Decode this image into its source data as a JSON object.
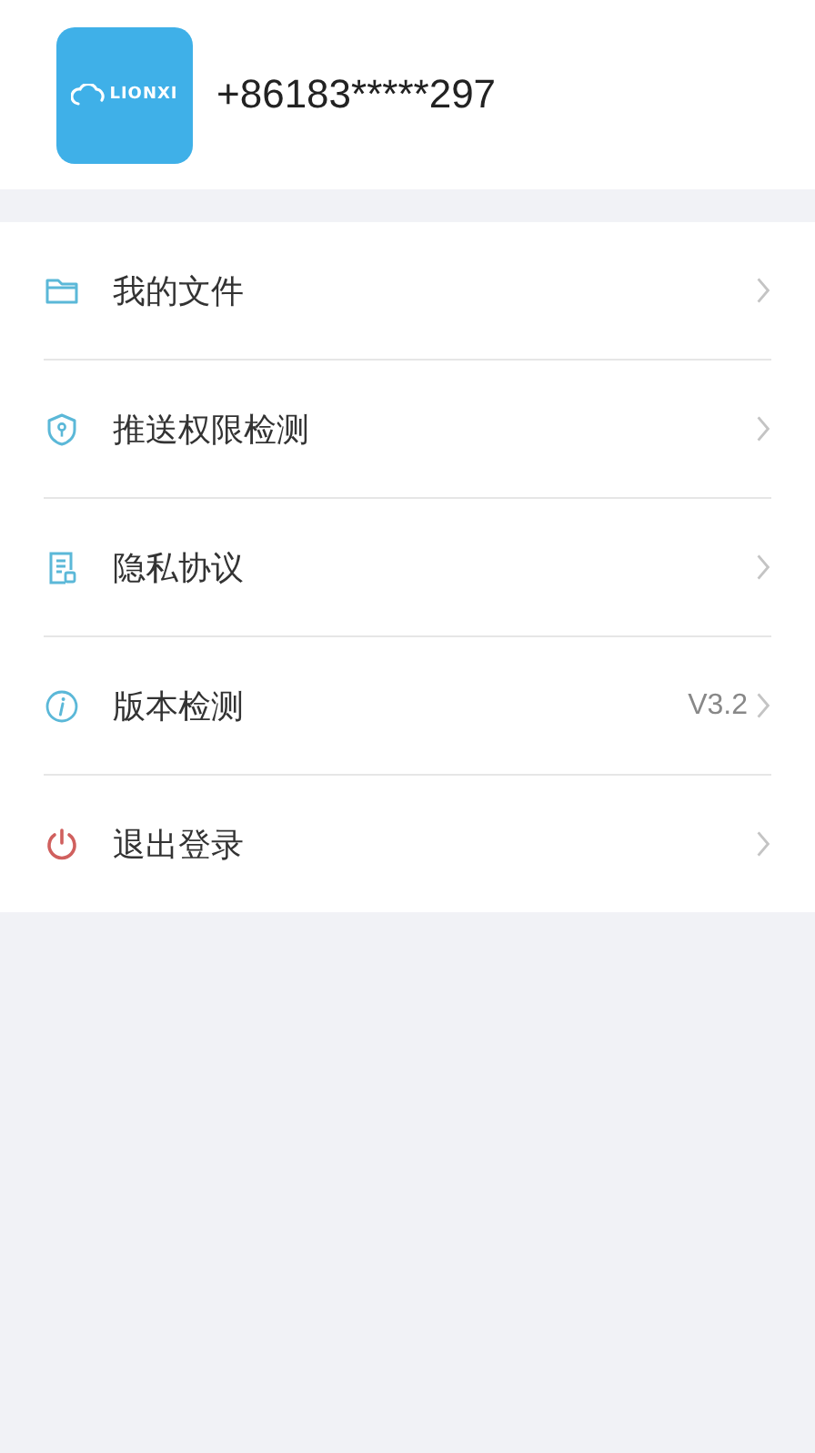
{
  "profile": {
    "logo_text": "LIONXI",
    "phone": "+86183*****297"
  },
  "menu": [
    {
      "kind": "folder",
      "label": "我的文件"
    },
    {
      "kind": "shield",
      "label": "推送权限检测"
    },
    {
      "kind": "document",
      "label": "隐私协议"
    },
    {
      "kind": "info",
      "label": "版本检测",
      "value": "V3.2"
    },
    {
      "kind": "power",
      "label": "退出登录"
    }
  ]
}
